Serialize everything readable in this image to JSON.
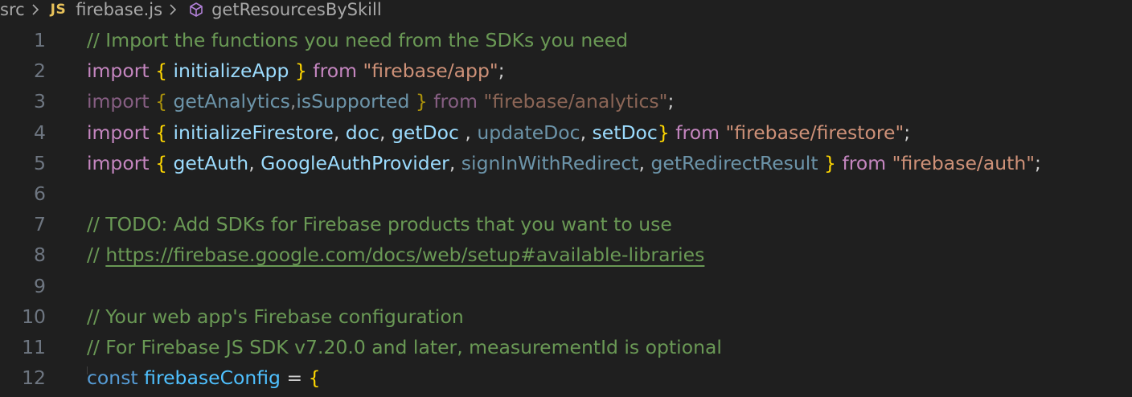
{
  "breadcrumb": {
    "folder": "src",
    "file_icon": "JS",
    "file": "firebase.js",
    "symbol_icon": "cube-icon",
    "symbol": "getResourcesBySkill"
  },
  "lines": [
    {
      "n": "1",
      "tokens": [
        {
          "t": "// Import the functions you need from the SDKs you need",
          "c": "c-com"
        }
      ]
    },
    {
      "n": "2",
      "tokens": [
        {
          "t": "import",
          "c": "c-kw"
        },
        {
          "t": " ",
          "c": "c-pl"
        },
        {
          "t": "{",
          "c": "c-br"
        },
        {
          "t": " ",
          "c": "c-pl"
        },
        {
          "t": "initializeApp",
          "c": "c-id"
        },
        {
          "t": " ",
          "c": "c-pl"
        },
        {
          "t": "}",
          "c": "c-br"
        },
        {
          "t": " ",
          "c": "c-pl"
        },
        {
          "t": "from",
          "c": "c-kw"
        },
        {
          "t": " ",
          "c": "c-pl"
        },
        {
          "t": "\"firebase/app\"",
          "c": "c-str"
        },
        {
          "t": ";",
          "c": "c-pl"
        }
      ]
    },
    {
      "n": "3",
      "tokens": [
        {
          "t": "import",
          "c": "c-kw-dim"
        },
        {
          "t": " ",
          "c": "c-pl"
        },
        {
          "t": "{",
          "c": "c-br-dim"
        },
        {
          "t": " ",
          "c": "c-pl"
        },
        {
          "t": "getAnalytics",
          "c": "c-id-dim"
        },
        {
          "t": ",",
          "c": "c-pl-dim"
        },
        {
          "t": "isSupported",
          "c": "c-id-dim"
        },
        {
          "t": " ",
          "c": "c-pl"
        },
        {
          "t": "}",
          "c": "c-br-dim"
        },
        {
          "t": " ",
          "c": "c-pl"
        },
        {
          "t": "from",
          "c": "c-kw-dim"
        },
        {
          "t": " ",
          "c": "c-pl"
        },
        {
          "t": "\"firebase/analytics\"",
          "c": "c-str-dim"
        },
        {
          "t": ";",
          "c": "c-pl"
        }
      ]
    },
    {
      "n": "4",
      "tokens": [
        {
          "t": "import",
          "c": "c-kw"
        },
        {
          "t": " ",
          "c": "c-pl"
        },
        {
          "t": "{",
          "c": "c-br"
        },
        {
          "t": " ",
          "c": "c-pl"
        },
        {
          "t": "initializeFirestore",
          "c": "c-id"
        },
        {
          "t": ", ",
          "c": "c-pl"
        },
        {
          "t": "doc",
          "c": "c-id"
        },
        {
          "t": ", ",
          "c": "c-pl"
        },
        {
          "t": "getDoc",
          "c": "c-id"
        },
        {
          "t": " , ",
          "c": "c-pl"
        },
        {
          "t": "updateDoc",
          "c": "c-id-dim"
        },
        {
          "t": ", ",
          "c": "c-pl"
        },
        {
          "t": "setDoc",
          "c": "c-id"
        },
        {
          "t": "}",
          "c": "c-br"
        },
        {
          "t": " ",
          "c": "c-pl"
        },
        {
          "t": "from",
          "c": "c-kw"
        },
        {
          "t": " ",
          "c": "c-pl"
        },
        {
          "t": "\"firebase/firestore\"",
          "c": "c-str"
        },
        {
          "t": ";",
          "c": "c-pl"
        }
      ]
    },
    {
      "n": "5",
      "tokens": [
        {
          "t": "import",
          "c": "c-kw"
        },
        {
          "t": " ",
          "c": "c-pl"
        },
        {
          "t": "{",
          "c": "c-br"
        },
        {
          "t": " ",
          "c": "c-pl"
        },
        {
          "t": "getAuth",
          "c": "c-id"
        },
        {
          "t": ", ",
          "c": "c-pl"
        },
        {
          "t": "GoogleAuthProvider",
          "c": "c-id"
        },
        {
          "t": ", ",
          "c": "c-pl"
        },
        {
          "t": "signInWithRedirect",
          "c": "c-id-dim"
        },
        {
          "t": ", ",
          "c": "c-pl"
        },
        {
          "t": "getRedirectResult",
          "c": "c-id-dim"
        },
        {
          "t": " ",
          "c": "c-pl"
        },
        {
          "t": "}",
          "c": "c-br"
        },
        {
          "t": " ",
          "c": "c-pl"
        },
        {
          "t": "from",
          "c": "c-kw"
        },
        {
          "t": " ",
          "c": "c-pl"
        },
        {
          "t": "\"firebase/auth\"",
          "c": "c-str"
        },
        {
          "t": ";",
          "c": "c-pl"
        }
      ]
    },
    {
      "n": "6",
      "tokens": []
    },
    {
      "n": "7",
      "tokens": [
        {
          "t": "// TODO: Add SDKs for Firebase products that you want to use",
          "c": "c-com"
        }
      ]
    },
    {
      "n": "8",
      "tokens": [
        {
          "t": "// ",
          "c": "c-com"
        },
        {
          "t": "https://firebase.google.com/docs/web/setup#available-libraries",
          "c": "c-link"
        }
      ]
    },
    {
      "n": "9",
      "tokens": []
    },
    {
      "n": "10",
      "tokens": [
        {
          "t": "// Your web app's Firebase configuration",
          "c": "c-com"
        }
      ]
    },
    {
      "n": "11",
      "tokens": [
        {
          "t": "// For Firebase JS SDK v7.20.0 and later, measurementId is optional",
          "c": "c-com"
        }
      ]
    },
    {
      "n": "12",
      "tokens": [
        {
          "t": "const",
          "c": "c-kw2"
        },
        {
          "t": " ",
          "c": "c-pl"
        },
        {
          "t": "firebaseConfig",
          "c": "c-const"
        },
        {
          "t": " = ",
          "c": "c-pl"
        },
        {
          "t": "{",
          "c": "c-br"
        }
      ]
    }
  ]
}
